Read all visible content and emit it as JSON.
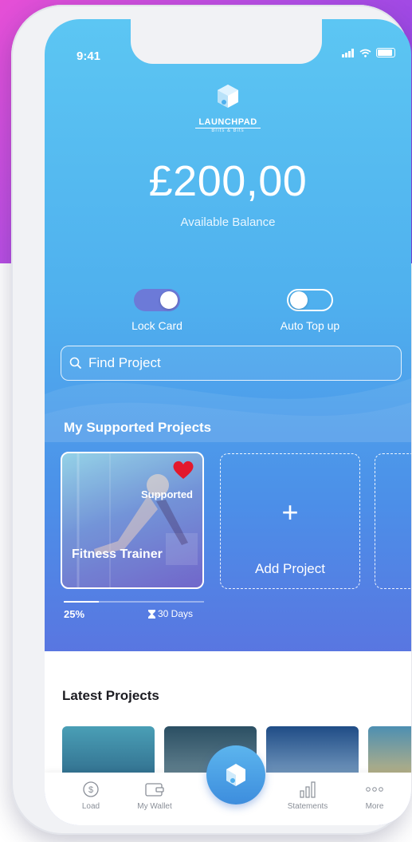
{
  "status_bar": {
    "time": "9:41"
  },
  "brand": {
    "name": "LAUNCHPAD",
    "tagline": "Brits & Bits"
  },
  "balance": {
    "amount": "£200,00",
    "label": "Available Balance"
  },
  "toggles": [
    {
      "label": "Lock Card",
      "on": true
    },
    {
      "label": "Auto Top up",
      "on": false
    }
  ],
  "search": {
    "placeholder": "Find Project"
  },
  "supported_projects": {
    "title": "My Supported Projects",
    "items": [
      {
        "name": "Fitness Trainer",
        "badge": "Supported",
        "progress_percent": 25,
        "progress_label": "25%",
        "duration": "30 Days"
      }
    ],
    "add_label": "Add Project"
  },
  "latest_projects": {
    "title": "Latest Projects"
  },
  "tabbar": {
    "items": [
      {
        "label": "Load",
        "icon": "dollar-refresh-icon"
      },
      {
        "label": "My Wallet",
        "icon": "wallet-icon"
      },
      {
        "label": "Statements",
        "icon": "bar-chart-icon"
      },
      {
        "label": "More",
        "icon": "more-dots-icon"
      }
    ],
    "center_icon": "launchpad-logo-icon"
  },
  "colors": {
    "accent": "#4fb0ee",
    "toggle_on": "#6c7ad8",
    "heart": "#e3182d"
  }
}
